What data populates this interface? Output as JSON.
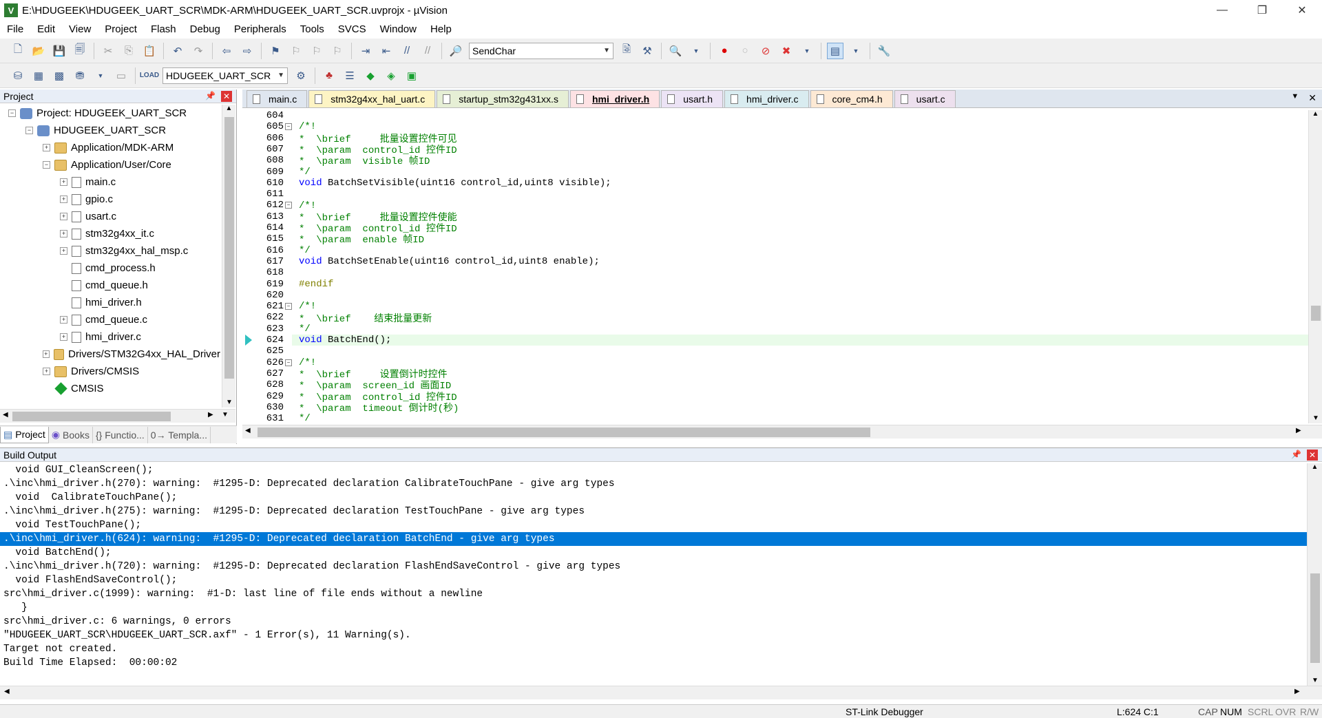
{
  "window": {
    "title": "E:\\HDUGEEK\\HDUGEEK_UART_SCR\\MDK-ARM\\HDUGEEK_UART_SCR.uvprojx - µVision",
    "app_icon_letter": "V",
    "minimize": "—",
    "restore": "❐",
    "close": "✕"
  },
  "menu": [
    "File",
    "Edit",
    "View",
    "Project",
    "Flash",
    "Debug",
    "Peripherals",
    "Tools",
    "SVCS",
    "Window",
    "Help"
  ],
  "toolbar1": {
    "find_combo": "SendChar"
  },
  "toolbar2": {
    "target_combo": "HDUGEEK_UART_SCR"
  },
  "project_panel": {
    "header": "Project",
    "tree": [
      {
        "label": "Project: HDUGEEK_UART_SCR",
        "indent": 0,
        "expander": "−",
        "icon": "project"
      },
      {
        "label": "HDUGEEK_UART_SCR",
        "indent": 1,
        "expander": "−",
        "icon": "target"
      },
      {
        "label": "Application/MDK-ARM",
        "indent": 2,
        "expander": "+",
        "icon": "folder"
      },
      {
        "label": "Application/User/Core",
        "indent": 2,
        "expander": "−",
        "icon": "folder"
      },
      {
        "label": "main.c",
        "indent": 3,
        "expander": "+",
        "icon": "file"
      },
      {
        "label": "gpio.c",
        "indent": 3,
        "expander": "+",
        "icon": "file"
      },
      {
        "label": "usart.c",
        "indent": 3,
        "expander": "+",
        "icon": "file"
      },
      {
        "label": "stm32g4xx_it.c",
        "indent": 3,
        "expander": "+",
        "icon": "file"
      },
      {
        "label": "stm32g4xx_hal_msp.c",
        "indent": 3,
        "expander": "+",
        "icon": "file"
      },
      {
        "label": "cmd_process.h",
        "indent": 3,
        "expander": "",
        "icon": "file"
      },
      {
        "label": "cmd_queue.h",
        "indent": 3,
        "expander": "",
        "icon": "file"
      },
      {
        "label": "hmi_driver.h",
        "indent": 3,
        "expander": "",
        "icon": "file"
      },
      {
        "label": "cmd_queue.c",
        "indent": 3,
        "expander": "+",
        "icon": "file"
      },
      {
        "label": "hmi_driver.c",
        "indent": 3,
        "expander": "+",
        "icon": "file"
      },
      {
        "label": "Drivers/STM32G4xx_HAL_Driver",
        "indent": 2,
        "expander": "+",
        "icon": "folder"
      },
      {
        "label": "Drivers/CMSIS",
        "indent": 2,
        "expander": "+",
        "icon": "folder"
      },
      {
        "label": "CMSIS",
        "indent": 2,
        "expander": "",
        "icon": "cmsis"
      }
    ],
    "tabs": [
      "Project",
      "Books",
      "{} Functio...",
      "0→ Templa..."
    ]
  },
  "editor": {
    "tabs": [
      {
        "label": "main.c",
        "color": "#dfe6ef",
        "active": false
      },
      {
        "label": "stm32g4xx_hal_uart.c",
        "color": "#fdf4c4",
        "active": false
      },
      {
        "label": "startup_stm32g431xx.s",
        "color": "#e6efd5",
        "active": false
      },
      {
        "label": "hmi_driver.h",
        "color": "#fde2e4",
        "active": true
      },
      {
        "label": "usart.h",
        "color": "#ece3f5",
        "active": false
      },
      {
        "label": "hmi_driver.c",
        "color": "#d9ecf0",
        "active": false
      },
      {
        "label": "core_cm4.h",
        "color": "#fde9d4",
        "active": false
      },
      {
        "label": "usart.c",
        "color": "#ede0ee",
        "active": false
      }
    ],
    "current_line": "624",
    "lines": [
      {
        "n": "604",
        "t": "",
        "c": ""
      },
      {
        "n": "605",
        "t": "/*!",
        "c": "cmt",
        "fold": true
      },
      {
        "n": "606",
        "t": "*  \\brief     批量设置控件可见",
        "c": "cmt"
      },
      {
        "n": "607",
        "t": "*  \\param  control_id 控件ID",
        "c": "cmt"
      },
      {
        "n": "608",
        "t": "*  \\param  visible 帧ID",
        "c": "cmt"
      },
      {
        "n": "609",
        "t": "*/",
        "c": "cmt"
      },
      {
        "n": "610",
        "t": "void BatchSetVisible(uint16 control_id,uint8 visible);",
        "c": "code"
      },
      {
        "n": "611",
        "t": "",
        "c": ""
      },
      {
        "n": "612",
        "t": "/*!",
        "c": "cmt",
        "fold": true
      },
      {
        "n": "613",
        "t": "*  \\brief     批量设置控件使能",
        "c": "cmt"
      },
      {
        "n": "614",
        "t": "*  \\param  control_id 控件ID",
        "c": "cmt"
      },
      {
        "n": "615",
        "t": "*  \\param  enable 帧ID",
        "c": "cmt"
      },
      {
        "n": "616",
        "t": "*/",
        "c": "cmt"
      },
      {
        "n": "617",
        "t": "void BatchSetEnable(uint16 control_id,uint8 enable);",
        "c": "code"
      },
      {
        "n": "618",
        "t": "",
        "c": ""
      },
      {
        "n": "619",
        "t": "#endif",
        "c": "pp"
      },
      {
        "n": "620",
        "t": "",
        "c": ""
      },
      {
        "n": "621",
        "t": "/*!",
        "c": "cmt",
        "fold": true
      },
      {
        "n": "622",
        "t": "*  \\brief    结束批量更新",
        "c": "cmt"
      },
      {
        "n": "623",
        "t": "*/",
        "c": "cmt"
      },
      {
        "n": "624",
        "t": "void BatchEnd();",
        "c": "code"
      },
      {
        "n": "625",
        "t": "",
        "c": ""
      },
      {
        "n": "626",
        "t": "/*!",
        "c": "cmt",
        "fold": true
      },
      {
        "n": "627",
        "t": "*  \\brief     设置倒计时控件",
        "c": "cmt"
      },
      {
        "n": "628",
        "t": "*  \\param  screen_id 画面ID",
        "c": "cmt"
      },
      {
        "n": "629",
        "t": "*  \\param  control_id 控件ID",
        "c": "cmt"
      },
      {
        "n": "630",
        "t": "*  \\param  timeout 倒计时(秒)",
        "c": "cmt"
      },
      {
        "n": "631",
        "t": "*/",
        "c": "cmt"
      }
    ]
  },
  "build_output": {
    "header": "Build Output",
    "selected_index": 5,
    "lines": [
      "  void GUI_CleanScreen();",
      ".\\inc\\hmi_driver.h(270): warning:  #1295-D: Deprecated declaration CalibrateTouchPane - give arg types",
      "  void  CalibrateTouchPane();",
      ".\\inc\\hmi_driver.h(275): warning:  #1295-D: Deprecated declaration TestTouchPane - give arg types",
      "  void TestTouchPane();",
      ".\\inc\\hmi_driver.h(624): warning:  #1295-D: Deprecated declaration BatchEnd - give arg types",
      "  void BatchEnd();",
      ".\\inc\\hmi_driver.h(720): warning:  #1295-D: Deprecated declaration FlashEndSaveControl - give arg types",
      "  void FlashEndSaveControl();",
      "src\\hmi_driver.c(1999): warning:  #1-D: last line of file ends without a newline",
      "   }",
      "src\\hmi_driver.c: 6 warnings, 0 errors",
      "\"HDUGEEK_UART_SCR\\HDUGEEK_UART_SCR.axf\" - 1 Error(s), 11 Warning(s).",
      "Target not created.",
      "Build Time Elapsed:  00:00:02"
    ]
  },
  "status": {
    "debugger": "ST-Link Debugger",
    "position": "L:624 C:1",
    "cap": "CAP",
    "num": "NUM",
    "scrl": "SCRL",
    "ovr": "OVR",
    "rw": "R/W"
  }
}
